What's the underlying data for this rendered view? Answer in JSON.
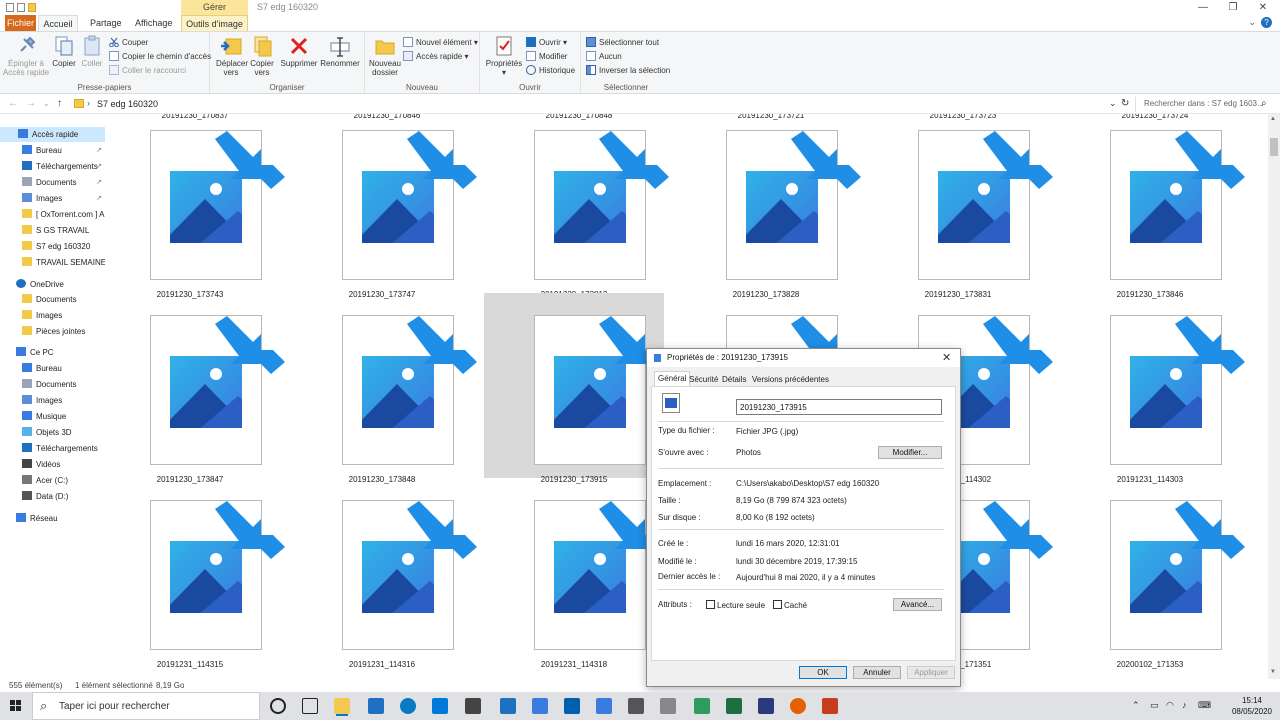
{
  "titlebar": {
    "context_label": "Gérer",
    "title": "S7 edg 160320"
  },
  "tabs": {
    "file": "Fichier",
    "home": "Accueil",
    "share": "Partage",
    "view": "Affichage",
    "picture_tools": "Outils d'image"
  },
  "ribbon": {
    "clipboard": {
      "label": "Presse-papiers",
      "pin": "Épingler à\nAccès rapide",
      "pin_l1": "Épingler à",
      "pin_l2": "Accès rapide",
      "copy": "Copier",
      "paste": "Coller",
      "cut": "Couper",
      "copy_path": "Copier le chemin d'accès",
      "paste_shortcut": "Coller le raccourci"
    },
    "organize": {
      "label": "Organiser",
      "move_l1": "Déplacer",
      "move_l2": "vers",
      "copyto_l1": "Copier",
      "copyto_l2": "vers",
      "delete": "Supprimer",
      "rename": "Renommer"
    },
    "new": {
      "label": "Nouveau",
      "folder_l1": "Nouveau",
      "folder_l2": "dossier",
      "new_item": "Nouvel élément",
      "easy_access": "Accès rapide"
    },
    "open": {
      "label": "Ouvrir",
      "properties": "Propriétés",
      "open": "Ouvrir",
      "edit": "Modifier",
      "history": "Historique"
    },
    "select": {
      "label": "Sélectionner",
      "select_all": "Sélectionner tout",
      "none": "Aucun",
      "invert": "Inverser la sélection"
    }
  },
  "address": {
    "path": "S7 edg 160320",
    "search_placeholder": "Rechercher dans : S7 edg 1603..."
  },
  "sidebar": {
    "quick_access": "Accès rapide",
    "qa_items": [
      "Bureau",
      "Téléchargements",
      "Documents",
      "Images",
      "[ OxTorrent.com ] A",
      "S GS TRAVAIL",
      "S7 edg 160320",
      "TRAVAIL SEMAINE 0"
    ],
    "onedrive": "OneDrive",
    "od_items": [
      "Documents",
      "Images",
      "Pièces jointes"
    ],
    "thispc": "Ce PC",
    "pc_items": [
      "Bureau",
      "Documents",
      "Images",
      "Musique",
      "Objets 3D",
      "Téléchargements",
      "Vidéos",
      "Acer (C:)",
      "Data (D:)"
    ],
    "network": "Réseau"
  },
  "files": {
    "top_row_partial": [
      "20191230_170837",
      "20191230_170846",
      "20191230_170848",
      "20191230_173721",
      "20191230_173723",
      "20191230_173724"
    ],
    "row1": [
      "20191230_173743",
      "20191230_173747",
      "20191230_173813",
      "20191230_173828",
      "20191230_173831",
      "20191230_173846"
    ],
    "row2": [
      "20191230_173847",
      "20191230_173848",
      "20191230_173915",
      "",
      "20191231_114302",
      "20191231_114303"
    ],
    "row3": [
      "20191231_114315",
      "20191231_114316",
      "20191231_114318",
      "",
      "20200102_171351",
      "20200102_171353"
    ]
  },
  "status": {
    "count": "555 élément(s)",
    "selection": "1 élément sélectionné",
    "size": "8,19 Go"
  },
  "dialog": {
    "title": "Propriétés de : 20191230_173915",
    "tabs": [
      "Général",
      "Sécurité",
      "Détails",
      "Versions précédentes"
    ],
    "filename": "20191230_173915",
    "type_label": "Type du fichier :",
    "type_value": "Fichier JPG (.jpg)",
    "opens_label": "S'ouvre avec :",
    "opens_value": "Photos",
    "modify_button": "Modifier...",
    "location_label": "Emplacement :",
    "location_value": "C:\\Users\\akabo\\Desktop\\S7 edg 160320",
    "size_label": "Taille :",
    "size_value": "8,19 Go (8 799 874 323 octets)",
    "disk_label": "Sur disque :",
    "disk_value": "8,00 Ko (8 192 octets)",
    "created_label": "Créé le :",
    "created_value": "lundi 16 mars 2020, 12:31:01",
    "modified_label": "Modifié le :",
    "modified_value": "lundi 30 décembre 2019, 17:39:15",
    "accessed_label": "Dernier accès le :",
    "accessed_value": "Aujourd'hui 8 mai 2020, il y a 4 minutes",
    "attributes_label": "Attributs :",
    "readonly": "Lecture seule",
    "hidden": "Caché",
    "advanced_button": "Avancé...",
    "ok": "OK",
    "cancel": "Annuler",
    "apply": "Appliquer"
  },
  "taskbar": {
    "search_placeholder": "Taper ici pour rechercher",
    "time": "15:14",
    "date": "08/05/2020"
  },
  "colors": {
    "accent": "#0078d7",
    "file_tab": "#d56a1c",
    "context_tab": "#fbe59b",
    "selection": "#cce8ff"
  }
}
